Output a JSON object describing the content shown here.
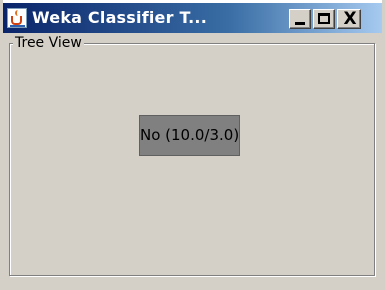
{
  "window": {
    "title": "Weka Classifier T...",
    "buttons": {
      "minimize": "_",
      "maximize": "□",
      "close": "X"
    }
  },
  "panel": {
    "legend": "Tree View"
  },
  "tree": {
    "root_node_label": "No (10.0/3.0)"
  },
  "icons": {
    "app": "java-cup-icon",
    "minimize": "minimize-icon",
    "maximize": "maximize-icon",
    "close": "close-icon"
  }
}
